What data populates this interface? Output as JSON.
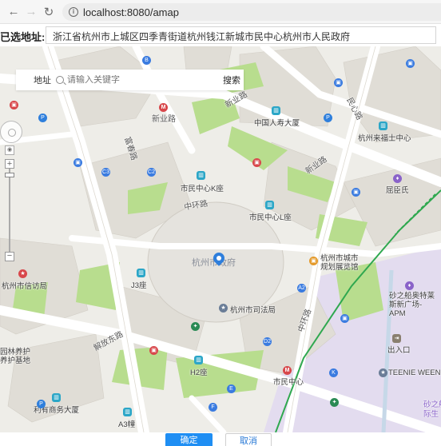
{
  "browser": {
    "back_icon": "arrow-left-icon",
    "forward_icon": "arrow-right-icon",
    "reload_icon": "reload-icon",
    "url": "localhost:8080/amap"
  },
  "address": {
    "label": "已选地址:",
    "value": "浙江省杭州市上城区四季青街道杭州钱江新城市民中心杭州市人民政府"
  },
  "search": {
    "label": "地址",
    "placeholder": "请输入关键字",
    "button": "搜索"
  },
  "map": {
    "center_label": "杭州市政府",
    "roads": {
      "xinye_road_1": "新业路",
      "xinye_road_2": "新业路",
      "mingyue_road": "民心路",
      "zhonghuan_road": "中环路",
      "zhonghuan_road_2": "中环路",
      "jiefang_east_road": "解放东路",
      "fuchun_road": "富春路",
      "xinye_road_3": "新业路"
    },
    "pois": {
      "china_life": "中国人寿大厦",
      "laifushi": "杭州来福士中心",
      "quchenshi": "屈臣氏",
      "shimin_k": "市民中心K座",
      "shimin_l": "市民中心L座",
      "city_planning": "杭州市城市规划展览馆",
      "j3": "J3座",
      "xinfang": "杭州市信访局",
      "sifa": "杭州市司法局",
      "h2": "H2座",
      "shimin_center": "市民中心",
      "yuanlin": "园林养护养护基地",
      "liyou": "利有商务大厦",
      "a3": "A3幢",
      "shazhichuan": "砂之船奥特莱斯新广场-APM",
      "churukou": "出入口",
      "teenie": "TEENIE WEENIE",
      "shamen": "砂之船",
      "jisheng": "际生"
    },
    "metro_codes": {
      "c3": "C3",
      "c2": "C2",
      "a2": "A2",
      "d2": "D2",
      "e": "E",
      "k": "K",
      "f": "F",
      "b": "B",
      "p": "P"
    }
  },
  "footer": {
    "ok": "确定",
    "cancel": "取消"
  }
}
